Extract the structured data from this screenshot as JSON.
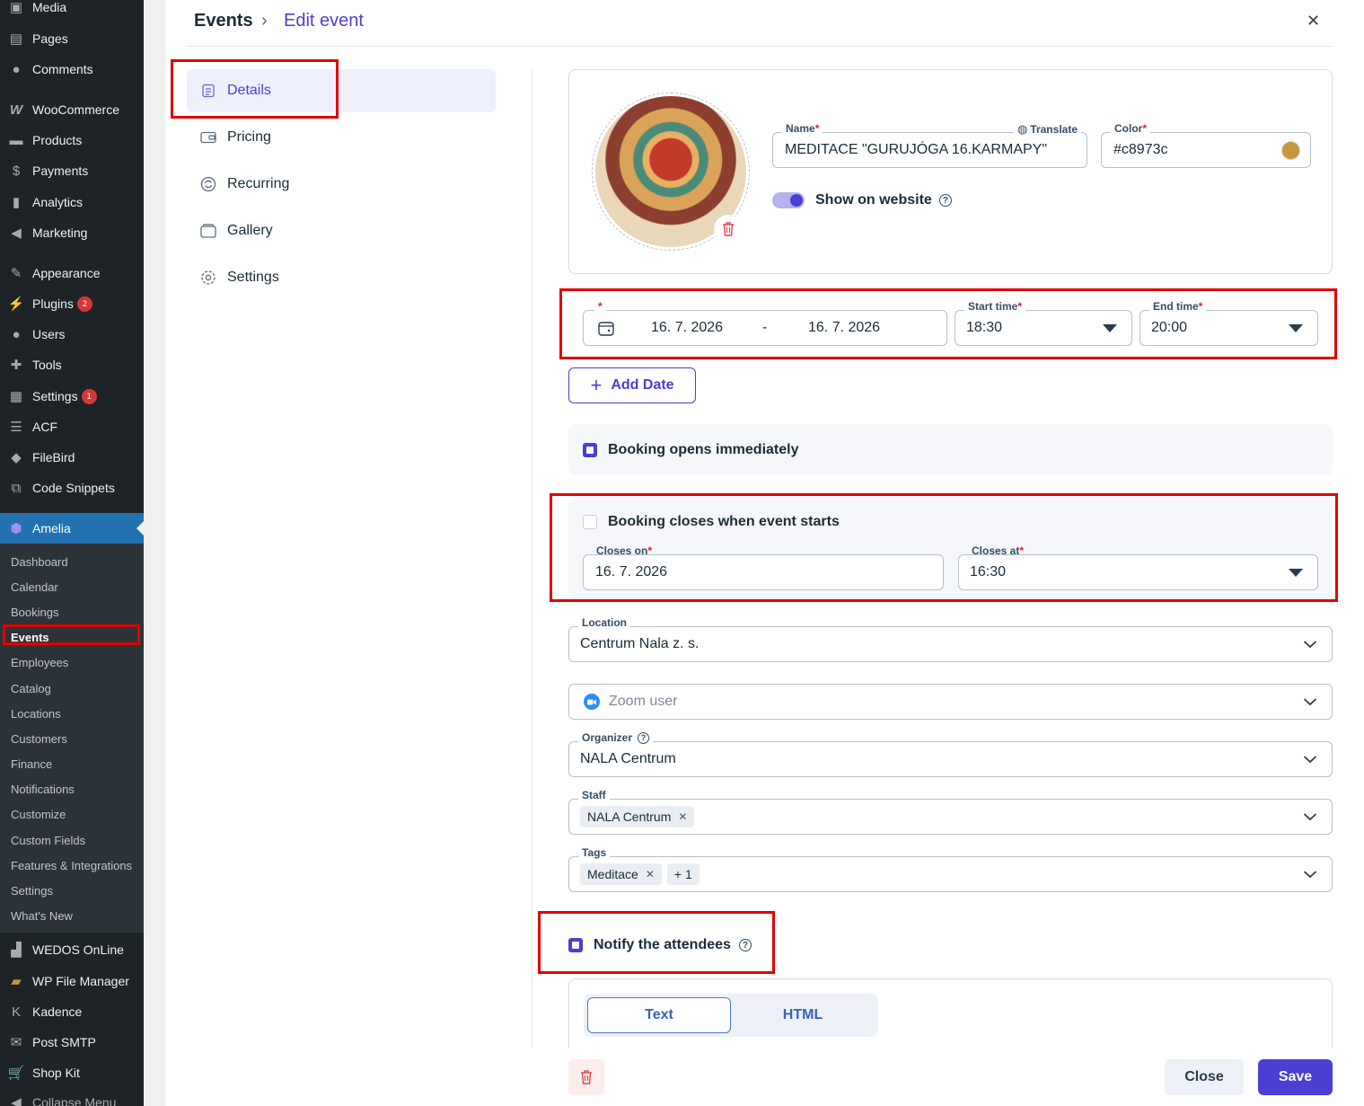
{
  "wp_menu": [
    {
      "key": "media",
      "label": "Media",
      "icon": "media-icon"
    },
    {
      "key": "pages",
      "label": "Pages",
      "icon": "pages-icon"
    },
    {
      "key": "comments",
      "label": "Comments",
      "icon": "comments-icon"
    },
    {
      "key": "woocommerce",
      "label": "WooCommerce",
      "icon": "woocommerce-icon"
    },
    {
      "key": "products",
      "label": "Products",
      "icon": "products-icon"
    },
    {
      "key": "payments",
      "label": "Payments",
      "icon": "payments-icon"
    },
    {
      "key": "analytics",
      "label": "Analytics",
      "icon": "analytics-icon"
    },
    {
      "key": "marketing",
      "label": "Marketing",
      "icon": "megaphone-icon"
    },
    {
      "key": "appearance",
      "label": "Appearance",
      "icon": "brush-icon"
    },
    {
      "key": "plugins",
      "label": "Plugins",
      "icon": "plug-icon",
      "badge": "2"
    },
    {
      "key": "users",
      "label": "Users",
      "icon": "user-icon"
    },
    {
      "key": "tools",
      "label": "Tools",
      "icon": "wrench-icon"
    },
    {
      "key": "settings",
      "label": "Settings",
      "icon": "settings-icon",
      "badge": "1"
    },
    {
      "key": "acf",
      "label": "ACF",
      "icon": "acf-icon"
    },
    {
      "key": "filebird",
      "label": "FileBird",
      "icon": "filebird-icon"
    },
    {
      "key": "code_snippets",
      "label": "Code Snippets",
      "icon": "code-icon"
    },
    {
      "key": "amelia",
      "label": "Amelia",
      "icon": "amelia-icon"
    },
    {
      "key": "wedos",
      "label": "WEDOS OnLine",
      "icon": "wedos-icon"
    },
    {
      "key": "wp_file_manager",
      "label": "WP File Manager",
      "icon": "folder-icon"
    },
    {
      "key": "kadence",
      "label": "Kadence",
      "icon": "kadence-icon"
    },
    {
      "key": "post_smtp",
      "label": "Post SMTP",
      "icon": "mail-icon"
    },
    {
      "key": "shop_kit",
      "label": "Shop Kit",
      "icon": "cart-icon"
    },
    {
      "key": "collapse",
      "label": "Collapse Menu",
      "icon": "collapse-icon"
    }
  ],
  "amelia_submenu": [
    "Dashboard",
    "Calendar",
    "Bookings",
    "Events",
    "Employees",
    "Catalog",
    "Locations",
    "Customers",
    "Finance",
    "Notifications",
    "Customize",
    "Custom Fields",
    "Features & Integrations",
    "Settings",
    "What's New"
  ],
  "header": {
    "parent": "Events",
    "separator": "›",
    "current": "Edit event",
    "close": "✕"
  },
  "tabs": [
    "Details",
    "Pricing",
    "Recurring",
    "Gallery",
    "Settings"
  ],
  "event": {
    "name_label": "Name",
    "translate": "Translate",
    "name_value": "MEDITACE \"GURUJÓGA 16.KARMAPY\"",
    "color_label": "Color",
    "color_value": "#c8973c",
    "color_swatch": "#c8973c",
    "show_on_website": "Show on website",
    "required": "*"
  },
  "dates": {
    "start_date": "16. 7. 2026",
    "range_sep": "-",
    "end_date": "16. 7. 2026",
    "start_time_label": "Start time",
    "start_time": "18:30",
    "end_time_label": "End time",
    "end_time": "20:00",
    "add_date": "Add Date",
    "add_icon": "+"
  },
  "booking": {
    "opens_immediately": "Booking opens immediately",
    "opens_checked": true,
    "closes_when_starts": "Booking closes when event starts",
    "closes_checked": false,
    "closes_on_label": "Closes on",
    "closes_on": "16. 7. 2026",
    "closes_at_label": "Closes at",
    "closes_at": "16:30"
  },
  "location": {
    "label": "Location",
    "value": "Centrum Nala z. s."
  },
  "zoom": {
    "placeholder": "Zoom user"
  },
  "organizer": {
    "label": "Organizer",
    "value": "NALA Centrum"
  },
  "staff": {
    "label": "Staff",
    "chips": [
      "NALA Centrum"
    ]
  },
  "tags": {
    "label": "Tags",
    "chips": [
      "Meditace"
    ],
    "more": "+ 1"
  },
  "notify": {
    "label": "Notify the attendees",
    "checked": true
  },
  "editor_tabs": {
    "text": "Text",
    "html": "HTML"
  },
  "footer": {
    "close": "Close",
    "save": "Save"
  },
  "colors": {
    "accent": "#4a3fd1",
    "wp_sidebar": "#1d2327",
    "wp_active": "#2271b1",
    "highlight": "#e00000",
    "danger": "#e5484d"
  }
}
